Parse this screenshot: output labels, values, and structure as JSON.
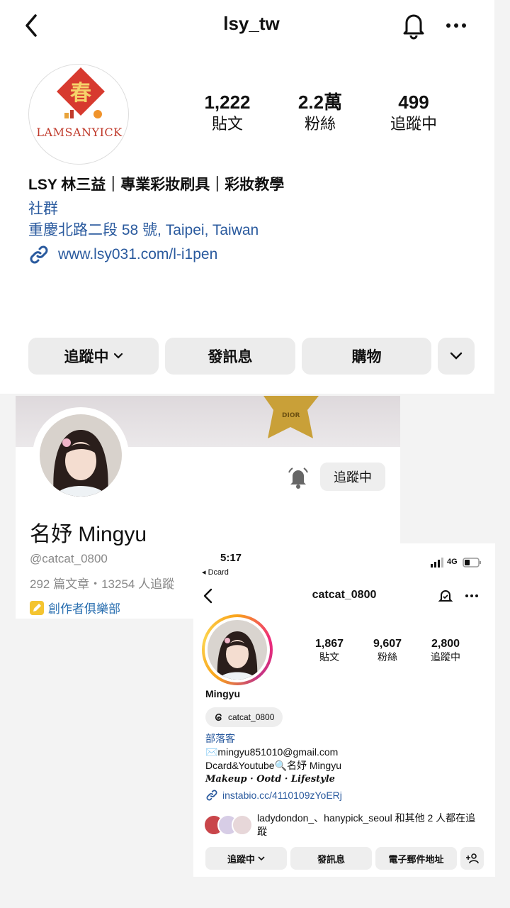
{
  "panel1": {
    "title": "lsy_tw",
    "avatar_logo_char": "春",
    "avatar_logo_text": "LAMSANYICK",
    "stats": [
      {
        "num": "1,222",
        "label": "貼文"
      },
      {
        "num": "2.2萬",
        "label": "粉絲"
      },
      {
        "num": "499",
        "label": "追蹤中"
      }
    ],
    "name": "LSY 林三益｜專業彩妝刷具｜彩妝教學",
    "category": "社群",
    "address": "重慶北路二段 58 號, Taipei, Taiwan",
    "link": "www.lsy031.com/l-i1pen",
    "buttons": {
      "following": "追蹤中",
      "message": "發訊息",
      "shop": "購物"
    },
    "icons": [
      "chevron-left-icon",
      "bell-icon",
      "more-icon",
      "link-icon",
      "chevron-down-icon"
    ],
    "colors": {
      "link": "#2a5a9e",
      "logo_red": "#d73a2f"
    }
  },
  "panel2": {
    "cover_text": "DIOR",
    "follow_label": "追蹤中",
    "name": "名妤 Mingyu",
    "handle": "@catcat_0800",
    "stats": "292 篇文章・13254 人追蹤",
    "club": "創作者俱樂部",
    "icons": [
      "bell-icon",
      "pencil-badge-icon"
    ]
  },
  "panel3": {
    "status_time": "5:17",
    "back_app": "◂ Dcard",
    "network": "4G",
    "title": "catcat_0800",
    "stats": [
      {
        "num": "1,867",
        "label": "貼文"
      },
      {
        "num": "9,607",
        "label": "粉絲"
      },
      {
        "num": "2,800",
        "label": "追蹤中"
      }
    ],
    "name": "Mingyu",
    "threads_handle": "catcat_0800",
    "bio": {
      "category": "部落客",
      "email": "✉️mingyu851010@gmail.com",
      "channels": "Dcard&Youtube🔍名妤 Mingyu",
      "tagline": "Makeup · Ootd · Lifestyle"
    },
    "link": "instabio.cc/4110109zYoERj",
    "mutual": "ladydondon_、hanypick_seoul 和其他 2 人都在追蹤",
    "buttons": {
      "following": "追蹤中",
      "message": "發訊息",
      "email": "電子郵件地址"
    },
    "icons": [
      "chevron-left-icon",
      "threads-bell-icon",
      "more-icon",
      "threads-icon",
      "link-icon",
      "add-person-icon",
      "signal-icon",
      "battery-icon"
    ]
  }
}
